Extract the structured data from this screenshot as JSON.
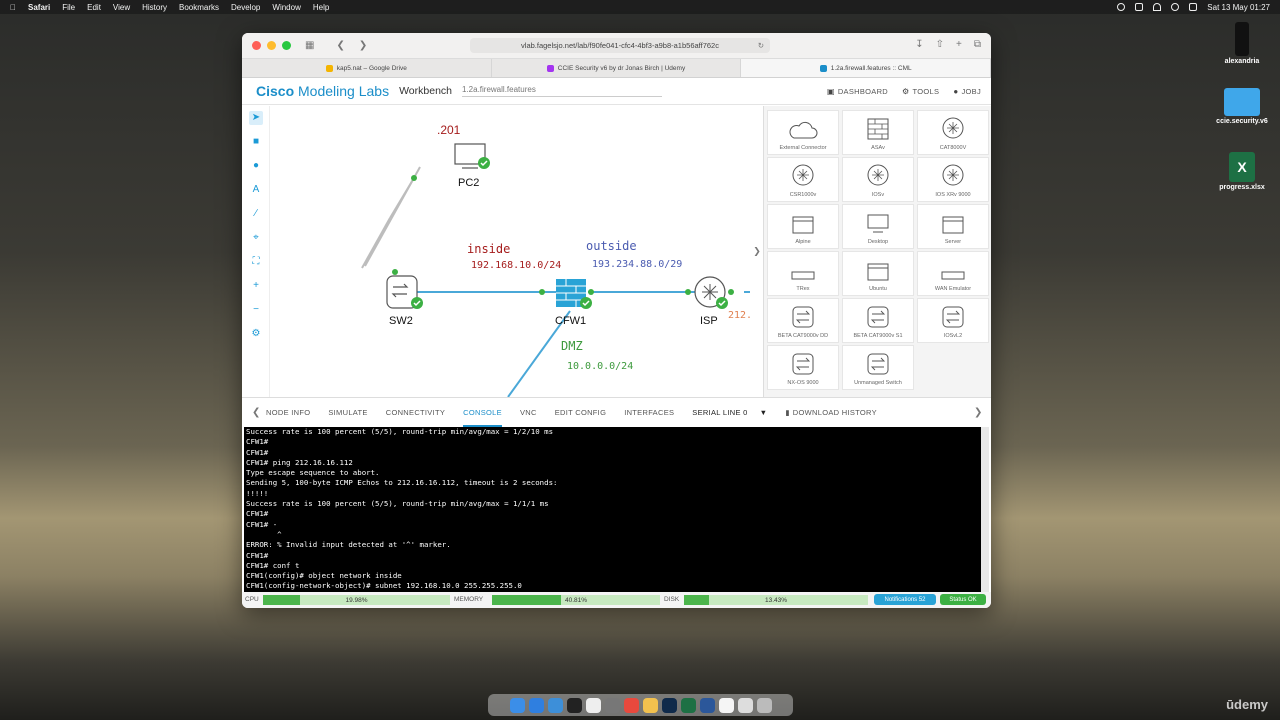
{
  "menubar": {
    "app": "Safari",
    "items": [
      "File",
      "Edit",
      "View",
      "History",
      "Bookmarks",
      "Develop",
      "Window",
      "Help"
    ],
    "clock": "Sat 13 May 01:27"
  },
  "desktop": {
    "icons": [
      {
        "label": "alexandria"
      },
      {
        "label": "ccie.security.v6"
      },
      {
        "label": "progress.xlsx"
      }
    ]
  },
  "browser": {
    "url": "vlab.fagelsjo.net/lab/f90fe041-cfc4-4bf3-a9b8-a1b56aff762c",
    "tabs": [
      {
        "label": "kap5.nat – Google Drive",
        "color": "#f4b400"
      },
      {
        "label": "CCIE Security v6 by dr Jonas Birch | Udemy",
        "color": "#a435f0"
      },
      {
        "label": "1.2a.firewall.features :: CML",
        "color": "#1b8ec9"
      }
    ]
  },
  "cml": {
    "brand_bold": "Cisco",
    "brand_rest": " Modeling Labs",
    "workbench": "Workbench",
    "lab_name": "1.2a.firewall.features",
    "actions": [
      "DASHBOARD",
      "TOOLS",
      "JOBJ"
    ]
  },
  "canvas": {
    "nodes": {
      "pc2": "PC2",
      "sw2": "SW2",
      "cfw1": "CFW1",
      "isp": "ISP"
    },
    "annotations": {
      "pc_ip": ".201",
      "inside": "inside",
      "inside_net": "192.168.10.0/24",
      "outside": "outside",
      "outside_net": "193.234.88.0/29",
      "isp_ip": "212.",
      "dmz": "DMZ",
      "dmz_net": "10.0.0.0/24"
    },
    "colors": {
      "inside": "#a51c1c",
      "outside": "#4a5bb0",
      "dmz": "#3d9a3d",
      "link": "#4aa8d8",
      "up": "#3cb043"
    }
  },
  "palette": [
    {
      "label": "External Connector",
      "icon": "cloud-icon"
    },
    {
      "label": "ASAv",
      "icon": "firewall-icon"
    },
    {
      "label": "CAT8000V",
      "icon": "router-icon"
    },
    {
      "label": "CSR1000v",
      "icon": "router-icon"
    },
    {
      "label": "IOSv",
      "icon": "router-icon"
    },
    {
      "label": "IOS XRv 9000",
      "icon": "router-icon"
    },
    {
      "label": "Alpine",
      "icon": "window-icon"
    },
    {
      "label": "Desktop",
      "icon": "monitor-icon"
    },
    {
      "label": "Server",
      "icon": "window-icon"
    },
    {
      "label": "TRex",
      "icon": "box-icon"
    },
    {
      "label": "Ubuntu",
      "icon": "window-icon"
    },
    {
      "label": "WAN Emulator",
      "icon": "box-icon"
    },
    {
      "label": "BETA CAT9000v DD",
      "icon": "switch-icon"
    },
    {
      "label": "BETA CAT9000v S1",
      "icon": "switch-icon"
    },
    {
      "label": "IOSvL2",
      "icon": "switch-icon"
    },
    {
      "label": "NX-OS 9000",
      "icon": "switch-icon"
    },
    {
      "label": "Unmanaged Switch",
      "icon": "switch-icon"
    }
  ],
  "detail_tabs": [
    "NODE INFO",
    "SIMULATE",
    "CONNECTIVITY",
    "CONSOLE",
    "VNC",
    "EDIT CONFIG",
    "INTERFACES"
  ],
  "active_tab": "CONSOLE",
  "serial_line": "SERIAL LINE 0",
  "download_history": "DOWNLOAD HISTORY",
  "console_lines": [
    "Success rate is 100 percent (5/5), round-trip min/avg/max = 1/2/10 ms",
    "CFW1#",
    "CFW1#",
    "CFW1# ping 212.16.16.112",
    "Type escape sequence to abort.",
    "Sending 5, 100-byte ICMP Echos to 212.16.16.112, timeout is 2 seconds:",
    "!!!!!",
    "Success rate is 100 percent (5/5), round-trip min/avg/max = 1/1/1 ms",
    "CFW1#",
    "CFW1# -",
    "       ^",
    "ERROR: % Invalid input detected at '^' marker.",
    "CFW1#",
    "CFW1# conf t",
    "CFW1(config)# object network inside",
    "CFW1(config-network-object)# subnet 192.168.10.0 255.255.255.0"
  ],
  "status": {
    "cpu_label": "CPU",
    "cpu_value": "19.98%",
    "cpu_fraction": 0.1998,
    "memory_label": "MEMORY",
    "memory_value": "40.81%",
    "memory_fraction": 0.4081,
    "disk_label": "DISK",
    "disk_value": "13.43%",
    "disk_fraction": 0.1343,
    "notifications": "Notifications 52",
    "status_ok": "Status OK"
  },
  "watermark": "ūdemy"
}
